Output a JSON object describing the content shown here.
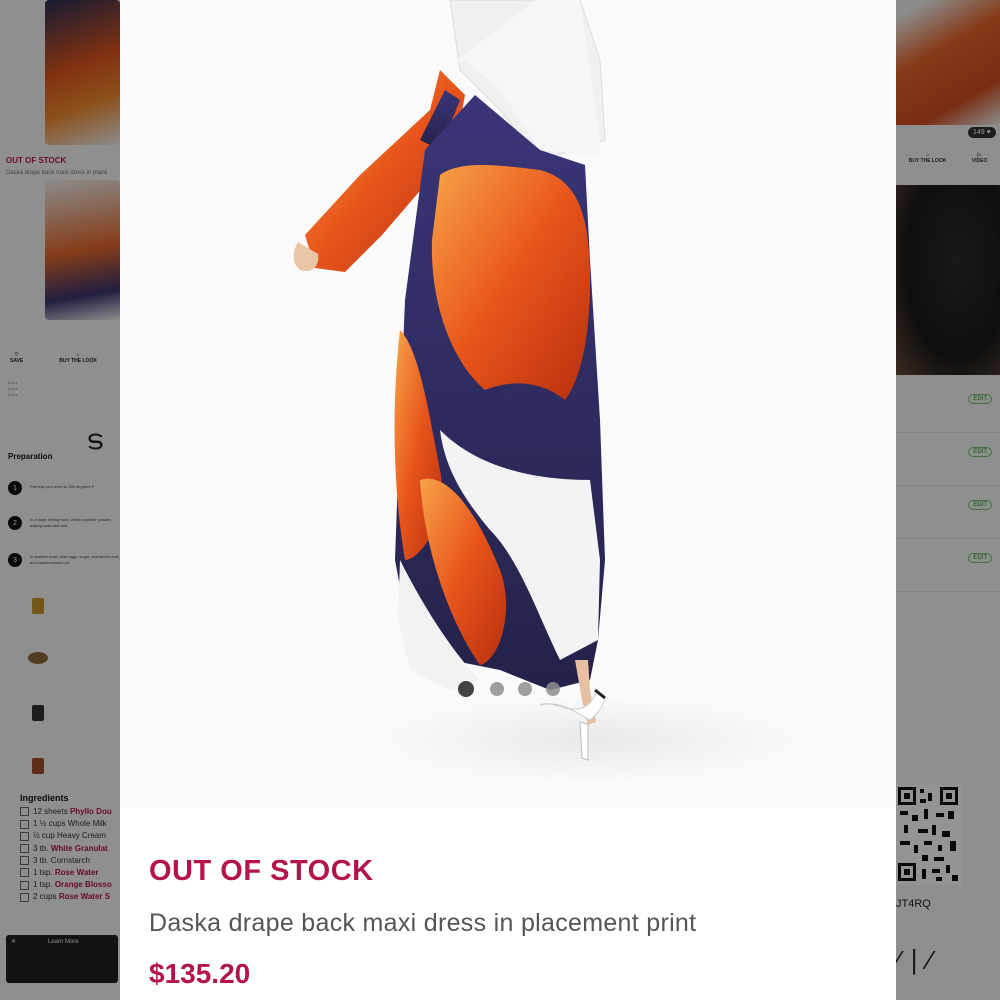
{
  "background": {
    "left_oos": "OUT OF STOCK",
    "left_desc": "Daska drape back maxi dress in place",
    "mini_actions": [
      "SAVE",
      "BUY THE LOOK"
    ],
    "prep_title": "Preparation",
    "steps": [
      "Preheat your oven to 350 degrees F.",
      "In a large mixing bowl, whisk together powder, baking soda and salt.",
      "In another bowl, beat eggs, sugar, and lemon zest, and vanilla extract unt"
    ],
    "ingredients_title": "Ingredients",
    "ingredients": [
      {
        "qty": "12 sheets",
        "name": "Phyllo Dou"
      },
      {
        "qty": "1 ½ cups Whole Milk",
        "name": ""
      },
      {
        "qty": "½ cup Heavy Cream",
        "name": ""
      },
      {
        "qty": "3 tb.",
        "name": "White Granulat"
      },
      {
        "qty": "3 tb. Cornstarch",
        "name": ""
      },
      {
        "qty": "1 tsp.",
        "name": "Rose Water"
      },
      {
        "qty": "1 tsp.",
        "name": "Orange Blosso"
      },
      {
        "qty": "2 cups",
        "name": "Rose Water S"
      }
    ],
    "player_label": "Learn More",
    "right_badge": "149",
    "right_actions": [
      "BUY THE LOOK",
      "VIDEO"
    ],
    "right_pill": "EDIT",
    "qr_code": "JT4RQ"
  },
  "modal": {
    "status": "OUT OF STOCK",
    "product_name": "Daska drape back maxi dress in placement print",
    "price": "$135.20",
    "carousel": {
      "count": 4,
      "active": 0
    }
  },
  "colors": {
    "accent": "#b5134e",
    "text_muted": "#555555"
  }
}
